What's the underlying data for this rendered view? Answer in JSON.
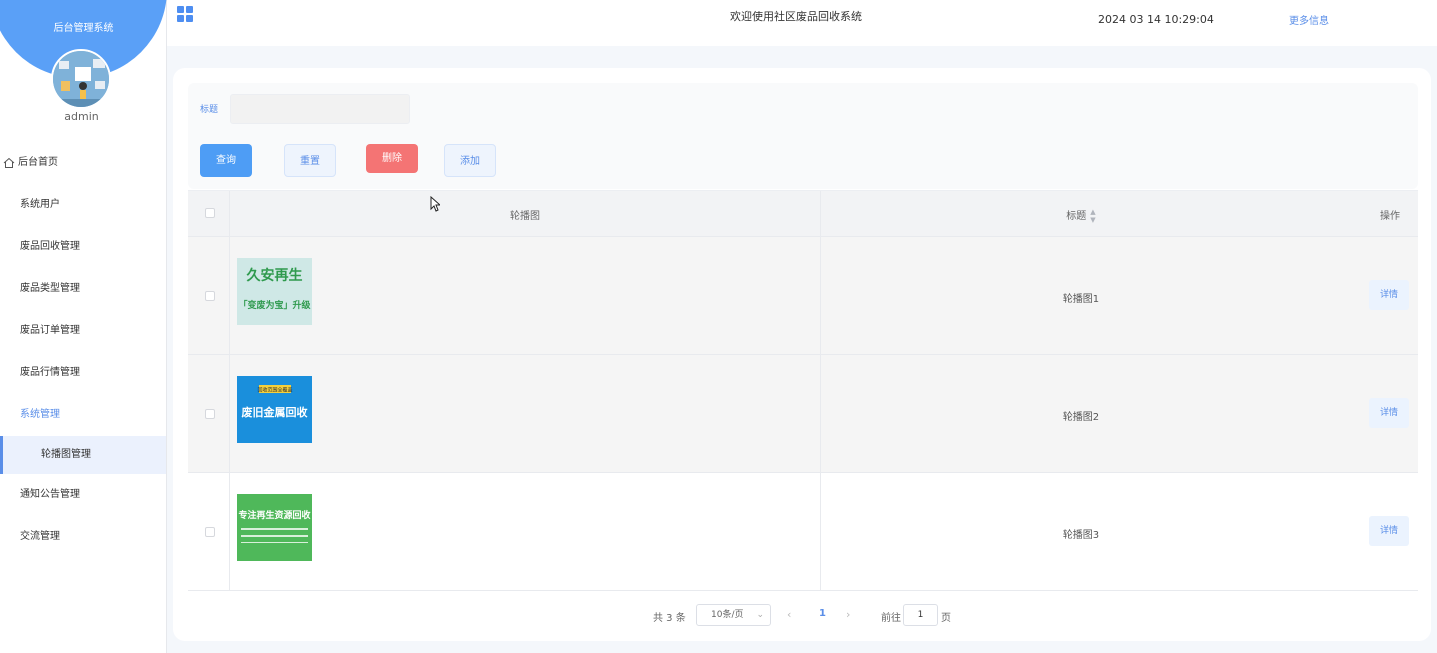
{
  "sidebar": {
    "brand_title": "后台管理系统",
    "username": "admin",
    "items": [
      {
        "label": "后台首页"
      },
      {
        "label": "系统用户"
      },
      {
        "label": "废品回收管理"
      },
      {
        "label": "废品类型管理"
      },
      {
        "label": "废品订单管理"
      },
      {
        "label": "废品行情管理"
      },
      {
        "label": "系统管理"
      },
      {
        "label": "轮播图管理"
      },
      {
        "label": "通知公告管理"
      },
      {
        "label": "交流管理"
      }
    ]
  },
  "header": {
    "welcome": "欢迎使用社区废品回收系统",
    "datetime": "2024 03 14 10:29:04",
    "more_info": "更多信息"
  },
  "search": {
    "label": "标题",
    "value": "",
    "query_label": "查询",
    "reset_label": "重置",
    "delete_label": "删除",
    "add_label": "添加"
  },
  "table": {
    "columns": {
      "image": "轮播图",
      "title": "标题",
      "operation": "操作"
    },
    "rows": [
      {
        "title": "轮播图1",
        "detail_label": "详情",
        "image": {
          "line1": "久安再生",
          "line2": "「变废为宝」升级",
          "bg": "#cfe8e6",
          "fg": "#2f9a4e"
        }
      },
      {
        "title": "轮播图2",
        "detail_label": "详情",
        "image": {
          "badge": "回收范围全覆盖",
          "line1": "废旧金属回收",
          "bg": "#1a8fdc",
          "fg": "#ffffff"
        }
      },
      {
        "title": "轮播图3",
        "detail_label": "详情",
        "image": {
          "line1": "专注再生资源回收",
          "bg": "#4fb85a",
          "fg": "#ffffff"
        }
      }
    ]
  },
  "pagination": {
    "total": "共 3 条",
    "page_size": "10条/页",
    "current": "1",
    "goto_label": "前往",
    "goto_value": "1",
    "page_suffix": "页"
  },
  "colors": {
    "primary": "#4e9df5",
    "danger": "#f47474",
    "accent": "#5a8ee8"
  }
}
